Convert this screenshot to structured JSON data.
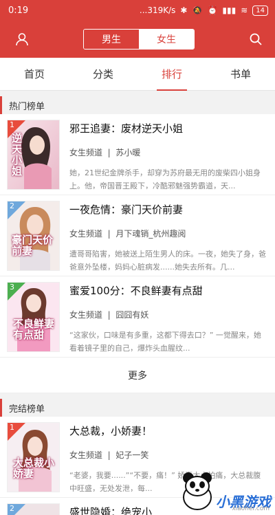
{
  "status": {
    "time": "0:19",
    "speed": "...319K/s",
    "battery": "14"
  },
  "header": {
    "gender_tabs": [
      {
        "label": "男生"
      },
      {
        "label": "女生"
      }
    ]
  },
  "tabs": [
    {
      "label": "首页"
    },
    {
      "label": "分类"
    },
    {
      "label": "排行"
    },
    {
      "label": "书单"
    }
  ],
  "hot": {
    "title": "热门榜单",
    "books": [
      {
        "rank": "1",
        "title": "邪王追妻：废材逆天小姐",
        "channel": "女生频道",
        "author": "苏小暖",
        "desc": "她，21世纪金牌杀手，却穿为苏府最无用的废柴四小姐身上。他，帝国晋王殿下，冷酷邪魅强势霸道，天...",
        "cover_text": "逆天小姐"
      },
      {
        "rank": "2",
        "title": "一夜危情：豪门天价前妻",
        "channel": "女生频道",
        "author": "月下魂销_杭州趣阅",
        "desc": "遭哥哥陷害，她被送上陌生男人的床。一夜，她失了身，爸爸意外坠楼，妈妈心脏病发......她失去所有。几...",
        "cover_text": "豪门天价前妻"
      },
      {
        "rank": "3",
        "title": "蜜爱100分：不良鲜妻有点甜",
        "channel": "女生频道",
        "author": "囧囧有妖",
        "desc": "“这家伙，口味是有多重，这都下得去口？” 一觉醒来，她看着镜子里的自己，爆炸头血腥纹...",
        "cover_text": "不良鲜妻有点甜"
      }
    ],
    "more_label": "更多"
  },
  "finished": {
    "title": "完结榜单",
    "books": [
      {
        "rank": "1",
        "title": "大总裁，小娇妻！",
        "channel": "女生频道",
        "author": "妃子一笑",
        "desc": "“老婆，我要......”“不要，痛！” 娇妻太小怕痛，大总裁腹中旺盛，无处发泄，每...",
        "cover_text": "大总裁小娇妻"
      },
      {
        "rank": "2",
        "title": "盛世隐婚：绝宠小"
      }
    ]
  },
  "watermark": {
    "text": "小黑游戏",
    "url": "xiaohei.com"
  },
  "colors": {
    "accent": "#d9403a"
  }
}
